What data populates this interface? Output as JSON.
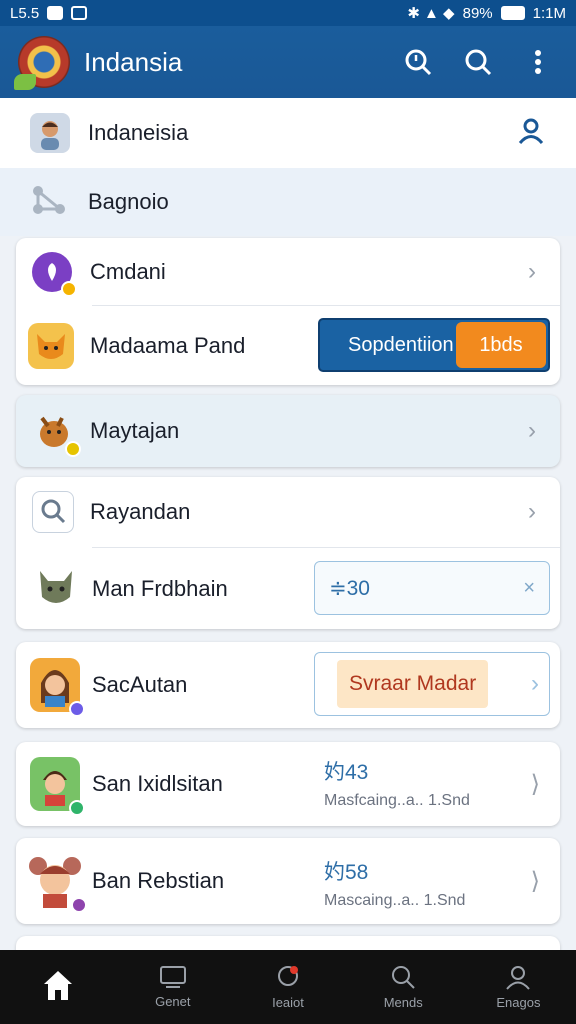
{
  "status_bar": {
    "left_text": "L5.5",
    "right_text": "89%",
    "time": "1:1M"
  },
  "app_bar": {
    "title": "Indansia",
    "icons": [
      "search-zoom-icon",
      "search-icon",
      "more-vert-icon"
    ]
  },
  "profile_row": {
    "name": "Indaneisia"
  },
  "section_header": {
    "label": "Bagnoio"
  },
  "group1": {
    "row1": {
      "label": "Cmdani"
    },
    "row2": {
      "label": "Madaama Pand",
      "button_text": "Sopdentiion",
      "button_badge": "1bds"
    }
  },
  "row_maytajan": {
    "label": "Maytajan"
  },
  "group2": {
    "row1": {
      "label": "Rayandan"
    },
    "row2": {
      "label": "Man Frdbhain",
      "input_value": "≑30",
      "clear": "×"
    }
  },
  "row_sachutan": {
    "label": "SacAutan",
    "button_text": "Svraar Madar"
  },
  "row_san": {
    "label": "San Ixidlsitan",
    "value": "妁43",
    "sub": "Masfcaing..a.. 1.Snd"
  },
  "row_ban": {
    "label": "Ban Rebstian",
    "value": "妁58",
    "sub": "Mascaing..a.. 1.Snd"
  },
  "bottom_nav": {
    "items": [
      {
        "label": "",
        "icon": "home-icon"
      },
      {
        "label": "Genet",
        "icon": "display-icon"
      },
      {
        "label": "Ieaiot",
        "icon": "chat-icon"
      },
      {
        "label": "Mends",
        "icon": "search-icon"
      },
      {
        "label": "Enagos",
        "icon": "profile-icon"
      }
    ]
  },
  "colors": {
    "accent": "#1a5896",
    "orange": "#f28a1e",
    "button_blue": "#1a62a3"
  }
}
